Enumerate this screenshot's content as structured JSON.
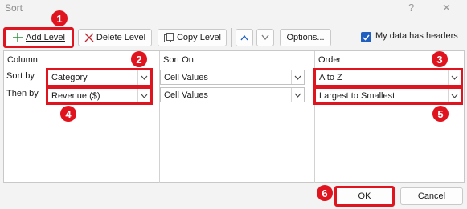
{
  "window": {
    "title": "Sort",
    "help_glyph": "?",
    "close_glyph": "✕"
  },
  "toolbar": {
    "add_level": "Add Level",
    "delete_level": "Delete Level",
    "copy_level": "Copy Level",
    "options": "Options...",
    "headers_checkbox_label": "My data has headers",
    "headers_checked": true
  },
  "grid": {
    "col_column": "Column",
    "col_sort_on": "Sort On",
    "col_order": "Order",
    "rows": [
      {
        "label": "Sort by",
        "column": "Category",
        "sort_on": "Cell Values",
        "order": "A to Z"
      },
      {
        "label": "Then by",
        "column": "Revenue ($)",
        "sort_on": "Cell Values",
        "order": "Largest to Smallest"
      }
    ]
  },
  "footer": {
    "ok": "OK",
    "cancel": "Cancel"
  },
  "callouts": [
    "1",
    "2",
    "3",
    "4",
    "5",
    "6"
  ],
  "colors": {
    "highlight": "#e0141e",
    "checkbox_blue": "#1f5fbf",
    "add_icon_green": "#2e8b3d",
    "delete_icon_red": "#c4262e"
  }
}
